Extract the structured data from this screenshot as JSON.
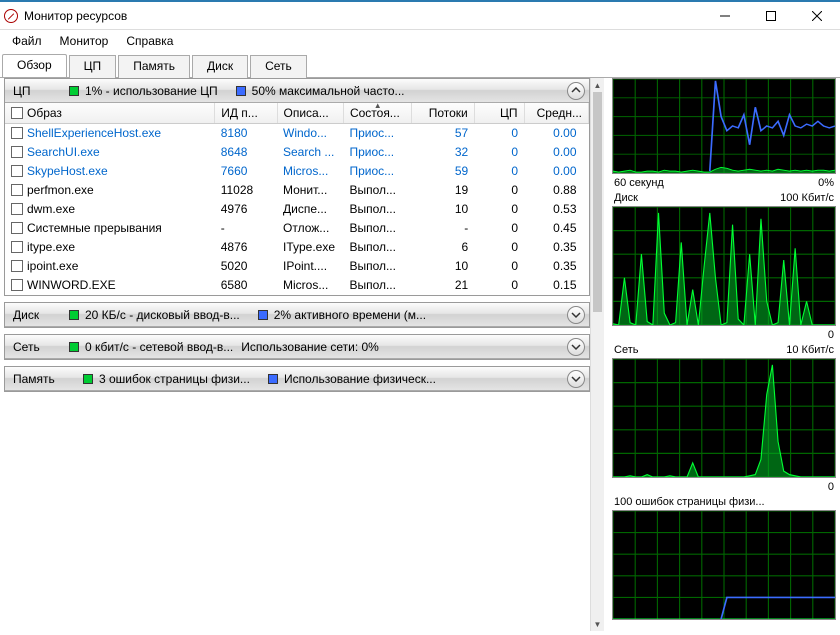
{
  "window": {
    "title": "Монитор ресурсов",
    "menu": [
      "Файл",
      "Монитор",
      "Справка"
    ],
    "tabs": [
      "Обзор",
      "ЦП",
      "Память",
      "Диск",
      "Сеть"
    ],
    "active_tab": 0
  },
  "cpu_section": {
    "title": "ЦП",
    "stat1": {
      "color": "#00cc33",
      "text": "1% - использование ЦП"
    },
    "stat2": {
      "color": "#3b6bff",
      "text": "50% максимальной часто..."
    },
    "columns": [
      "Образ",
      "ИД п...",
      "Описа...",
      "Состоя...",
      "Потоки",
      "ЦП",
      "Средн..."
    ],
    "sort_col": 3,
    "rows": [
      {
        "image": "ShellExperienceHost.exe",
        "pid": "8180",
        "desc": "Windo...",
        "status": "Приос...",
        "threads": "57",
        "cpu": "0",
        "avg": "0.00",
        "suspended": true
      },
      {
        "image": "SearchUI.exe",
        "pid": "8648",
        "desc": "Search ...",
        "status": "Приос...",
        "threads": "32",
        "cpu": "0",
        "avg": "0.00",
        "suspended": true
      },
      {
        "image": "SkypeHost.exe",
        "pid": "7660",
        "desc": "Micros...",
        "status": "Приос...",
        "threads": "59",
        "cpu": "0",
        "avg": "0.00",
        "suspended": true
      },
      {
        "image": "perfmon.exe",
        "pid": "11028",
        "desc": "Монит...",
        "status": "Выпол...",
        "threads": "19",
        "cpu": "0",
        "avg": "0.88",
        "suspended": false
      },
      {
        "image": "dwm.exe",
        "pid": "4976",
        "desc": "Диспе...",
        "status": "Выпол...",
        "threads": "10",
        "cpu": "0",
        "avg": "0.53",
        "suspended": false
      },
      {
        "image": "Системные прерывания",
        "pid": "-",
        "desc": "Отлож...",
        "status": "Выпол...",
        "threads": "-",
        "cpu": "0",
        "avg": "0.45",
        "suspended": false
      },
      {
        "image": "itype.exe",
        "pid": "4876",
        "desc": "IType.exe",
        "status": "Выпол...",
        "threads": "6",
        "cpu": "0",
        "avg": "0.35",
        "suspended": false
      },
      {
        "image": "ipoint.exe",
        "pid": "5020",
        "desc": "IPoint....",
        "status": "Выпол...",
        "threads": "10",
        "cpu": "0",
        "avg": "0.35",
        "suspended": false
      },
      {
        "image": "WINWORD.EXE",
        "pid": "6580",
        "desc": "Micros...",
        "status": "Выпол...",
        "threads": "21",
        "cpu": "0",
        "avg": "0.15",
        "suspended": false
      }
    ]
  },
  "disk_section": {
    "title": "Диск",
    "stat1": {
      "color": "#00cc33",
      "text": "20 КБ/с - дисковый ввод-в..."
    },
    "stat2": {
      "color": "#3b6bff",
      "text": "2% активного времени (м..."
    }
  },
  "net_section": {
    "title": "Сеть",
    "stat1": {
      "color": "#00cc33",
      "text": "0 кбит/с - сетевой ввод-в..."
    },
    "stat2": {
      "text": "Использование сети: 0%"
    }
  },
  "mem_section": {
    "title": "Память",
    "stat1": {
      "color": "#00cc33",
      "text": "3 ошибок страницы физи..."
    },
    "stat2": {
      "color": "#3b6bff",
      "text": "Использование физическ..."
    }
  },
  "graphs": {
    "g1_time": "60 секунд",
    "g1_right": "0%",
    "g2_title": "Диск",
    "g2_right": "100 Кбит/с",
    "g2_bottom": "0",
    "g3_title": "Сеть",
    "g3_right": "10 Кбит/с",
    "g3_bottom": "0",
    "g4_title": "100 ошибок страницы физи..."
  },
  "chart_data": [
    {
      "type": "line",
      "title": "ЦП",
      "x_label": "60 секунд",
      "ylim": [
        0,
        100
      ],
      "series": [
        {
          "name": "cpu-usage",
          "color": "#00ff33",
          "values_pct": [
            2,
            1,
            2,
            3,
            1,
            1,
            2,
            2,
            1,
            3,
            2,
            2,
            1,
            2,
            3,
            2,
            1,
            1,
            4,
            6,
            5,
            3,
            2,
            3,
            4,
            3,
            2,
            3,
            2,
            4,
            3,
            2,
            3,
            2,
            3,
            2,
            3,
            3,
            2,
            3
          ]
        },
        {
          "name": "cpu-max-freq",
          "color": "#3b6bff",
          "values_pct": [
            null,
            null,
            null,
            null,
            null,
            null,
            null,
            null,
            null,
            null,
            null,
            null,
            null,
            null,
            null,
            null,
            null,
            2,
            98,
            60,
            45,
            50,
            48,
            62,
            30,
            70,
            45,
            50,
            48,
            55,
            40,
            62,
            50,
            48,
            52,
            50,
            55,
            50,
            48,
            50
          ]
        }
      ]
    },
    {
      "type": "line",
      "title": "Диск",
      "ylabel": "100 Кбит/с",
      "ylim": [
        0,
        100
      ],
      "series": [
        {
          "name": "disk-io",
          "color": "#00ff33",
          "values_pct": [
            1,
            0,
            40,
            2,
            0,
            60,
            3,
            0,
            95,
            10,
            0,
            2,
            70,
            0,
            30,
            0,
            50,
            95,
            40,
            0,
            2,
            85,
            5,
            0,
            60,
            0,
            90,
            20,
            0,
            2,
            55,
            0,
            65,
            0,
            20,
            0,
            0,
            0,
            0,
            0
          ]
        }
      ]
    },
    {
      "type": "line",
      "title": "Сеть",
      "ylabel": "10 Кбит/с",
      "ylim": [
        0,
        10
      ],
      "series": [
        {
          "name": "net-io",
          "color": "#00ff33",
          "values_pct": [
            0,
            0,
            0,
            1,
            0,
            0,
            2,
            0,
            0,
            0,
            1,
            0,
            0,
            0,
            12,
            0,
            0,
            0,
            0,
            0,
            0,
            0,
            0,
            0,
            1,
            2,
            15,
            70,
            95,
            30,
            5,
            2,
            1,
            0,
            0,
            0,
            0,
            0,
            0,
            0
          ]
        }
      ]
    },
    {
      "type": "line",
      "title": "Ошибки страницы",
      "ylabel": "100 ошибок страницы физи...",
      "ylim": [
        0,
        100
      ],
      "series": [
        {
          "name": "hard-faults",
          "color": "#00ff33",
          "values_pct": [
            0,
            0,
            0,
            0,
            0,
            0,
            0,
            0,
            0,
            0,
            0,
            0,
            0,
            0,
            0,
            0,
            0,
            0,
            0,
            0,
            0,
            0,
            0,
            0,
            0,
            0,
            0,
            0,
            0,
            0,
            0,
            0,
            0,
            0,
            0,
            0,
            0,
            0,
            0,
            0
          ]
        },
        {
          "name": "mem-used",
          "color": "#3b6bff",
          "values_pct": [
            null,
            null,
            null,
            null,
            null,
            null,
            null,
            null,
            null,
            null,
            null,
            null,
            null,
            null,
            null,
            null,
            null,
            null,
            null,
            0,
            20,
            20,
            20,
            20,
            20,
            20,
            20,
            20,
            20,
            20,
            20,
            20,
            20,
            20,
            20,
            20,
            20,
            20,
            20,
            20
          ]
        }
      ]
    }
  ]
}
